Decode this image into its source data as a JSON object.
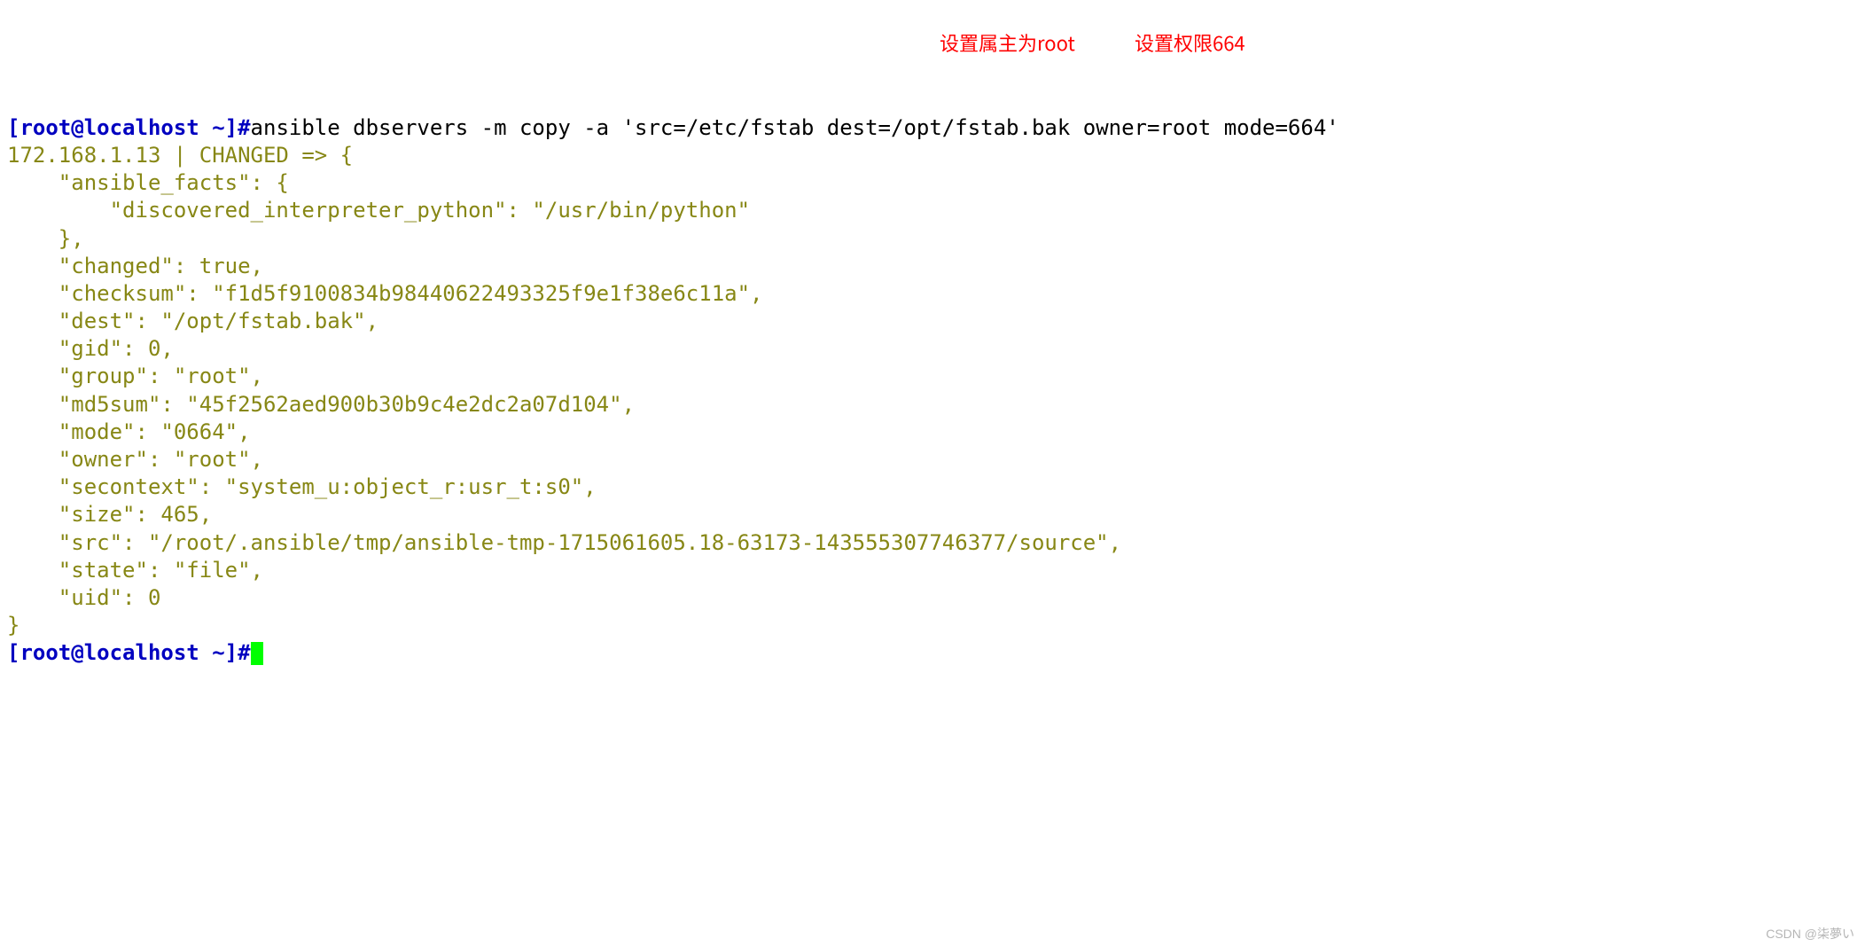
{
  "prompt1": {
    "bracket_open": "[",
    "userhost": "root@localhost ~",
    "bracket_close": "]#",
    "command": "ansible dbservers -m copy -a 'src=/etc/fstab dest=/opt/fstab.bak owner=root mode=664'"
  },
  "result_header": "172.168.1.13 | CHANGED => {",
  "lines": {
    "l2": "    \"ansible_facts\": {",
    "l3": "        \"discovered_interpreter_python\": \"/usr/bin/python\"",
    "l4": "    },",
    "l5": "    \"changed\": true,",
    "l6": "    \"checksum\": \"f1d5f9100834b98440622493325f9e1f38e6c11a\",",
    "l7": "    \"dest\": \"/opt/fstab.bak\",",
    "l8": "    \"gid\": 0,",
    "l9": "    \"group\": \"root\",",
    "l10": "    \"md5sum\": \"45f2562aed900b30b9c4e2dc2a07d104\",",
    "l11": "    \"mode\": \"0664\",",
    "l12": "    \"owner\": \"root\",",
    "l13": "    \"secontext\": \"system_u:object_r:usr_t:s0\",",
    "l14": "    \"size\": 465,",
    "l15": "    \"src\": \"/root/.ansible/tmp/ansible-tmp-1715061605.18-63173-143555307746377/source\",",
    "l16": "    \"state\": \"file\",",
    "l17": "    \"uid\": 0",
    "l18": "}"
  },
  "prompt2": {
    "bracket_open": "[",
    "userhost": "root@localhost ~",
    "bracket_close": "]#"
  },
  "annotations": {
    "owner": "设置属主为root",
    "mode": "设置权限664"
  },
  "watermark": "CSDN @柒夢い"
}
